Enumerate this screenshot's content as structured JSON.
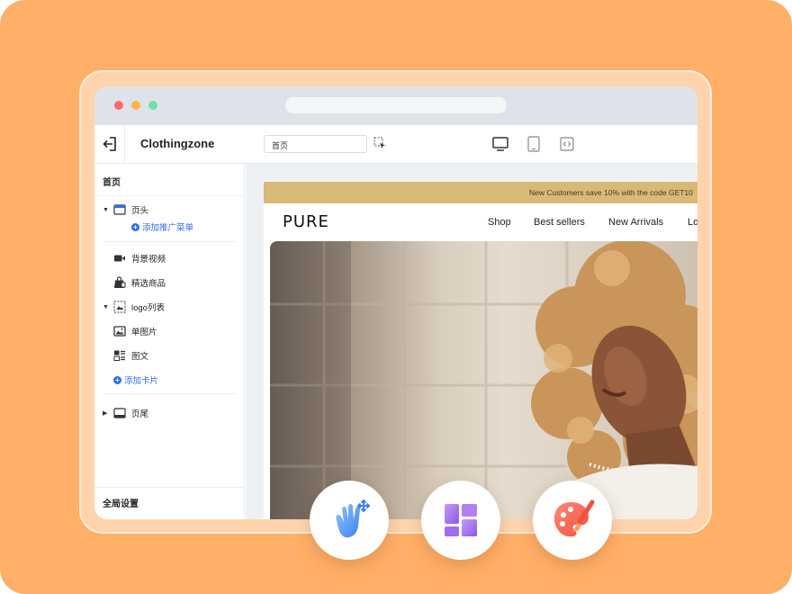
{
  "toolbar": {
    "site_name": "Clothingzone",
    "page_select_value": "首页"
  },
  "sidebar": {
    "title": "首页",
    "items": [
      {
        "label": "页头",
        "icon": "header-layout-icon",
        "expandable": true,
        "expanded": true
      },
      {
        "label": "添加推广菜单",
        "icon": "plus-circle-icon",
        "type": "add-link"
      },
      {
        "label": "背景视频",
        "icon": "video-camera-icon"
      },
      {
        "label": "精选商品",
        "icon": "shopping-bag-icon"
      },
      {
        "label": "logo列表",
        "icon": "logo-list-icon",
        "expandable": true,
        "expanded": true
      },
      {
        "label": "单图片",
        "icon": "image-icon"
      },
      {
        "label": "图文",
        "icon": "image-text-icon"
      },
      {
        "label": "添加卡片",
        "icon": "plus-circle-icon",
        "type": "add-link"
      },
      {
        "label": "页尾",
        "icon": "footer-layout-icon",
        "expandable": true,
        "expanded": false
      }
    ],
    "footer_label": "全局设置"
  },
  "preview": {
    "announcement": "New Customers save 10% with the code GET10",
    "logo": "PURE",
    "nav": [
      "Shop",
      "Best sellers",
      "New Arrivals",
      "Lo"
    ]
  },
  "colors": {
    "background": "#ffaf68",
    "accent_blue": "#2f6fe4",
    "announcement_bar": "#d9b977"
  },
  "badges": [
    "drag-hand-icon",
    "layout-grid-icon",
    "palette-brush-icon"
  ]
}
